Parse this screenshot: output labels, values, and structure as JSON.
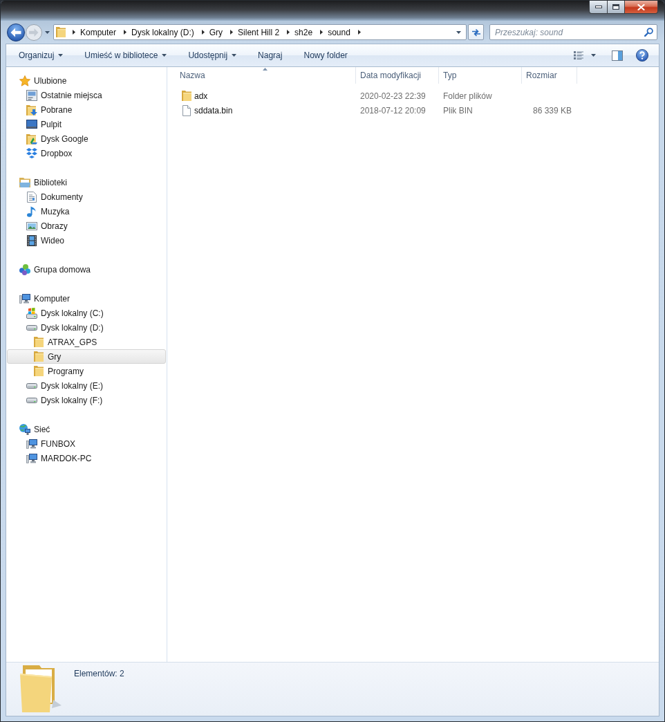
{
  "navigation": {
    "back_enabled": true,
    "forward_enabled": false,
    "breadcrumbs": [
      "Komputer",
      "Dysk lokalny (D:)",
      "Gry",
      "Silent Hill 2",
      "sh2e",
      "sound"
    ]
  },
  "search": {
    "placeholder": "Przeszukaj: sound"
  },
  "toolbar": {
    "items": [
      {
        "label": "Organizuj",
        "menu": true
      },
      {
        "label": "Umieść w bibliotece",
        "menu": true
      },
      {
        "label": "Udostępnij",
        "menu": true
      },
      {
        "label": "Nagraj",
        "menu": false
      },
      {
        "label": "Nowy folder",
        "menu": false
      }
    ]
  },
  "sidebar": {
    "items": [
      {
        "label": "Ulubione",
        "kind": "favorites",
        "selected": false,
        "children": [
          {
            "label": "Ostatnie miejsca",
            "kind": "recent",
            "selected": false
          },
          {
            "label": "Pobrane",
            "kind": "downloads",
            "selected": false
          },
          {
            "label": "Pulpit",
            "kind": "desktop",
            "selected": false
          },
          {
            "label": "Dysk Google",
            "kind": "gdrive",
            "selected": false
          },
          {
            "label": "Dropbox",
            "kind": "dropbox",
            "selected": false
          }
        ]
      },
      {
        "label": "Biblioteki",
        "kind": "libraries",
        "selected": false,
        "children": [
          {
            "label": "Dokumenty",
            "kind": "documents",
            "selected": false
          },
          {
            "label": "Muzyka",
            "kind": "music",
            "selected": false
          },
          {
            "label": "Obrazy",
            "kind": "pictures",
            "selected": false
          },
          {
            "label": "Wideo",
            "kind": "videos",
            "selected": false
          }
        ]
      },
      {
        "label": "Grupa domowa",
        "kind": "homegroup",
        "selected": false
      },
      {
        "label": "Komputer",
        "kind": "computer",
        "selected": false,
        "children": [
          {
            "label": "Dysk lokalny (C:)",
            "kind": "sysdrive",
            "selected": false
          },
          {
            "label": "Dysk lokalny (D:)",
            "kind": "drive",
            "selected": false,
            "children": [
              {
                "label": "ATRAX_GPS",
                "kind": "folder",
                "selected": false
              },
              {
                "label": "Gry",
                "kind": "folder",
                "selected": true
              },
              {
                "label": "Programy",
                "kind": "folder",
                "selected": false
              }
            ]
          },
          {
            "label": "Dysk lokalny (E:)",
            "kind": "drive",
            "selected": false
          },
          {
            "label": "Dysk lokalny (F:)",
            "kind": "drive",
            "selected": false
          }
        ]
      },
      {
        "label": "Sieć",
        "kind": "network",
        "selected": false,
        "children": [
          {
            "label": "FUNBOX",
            "kind": "pc",
            "selected": false
          },
          {
            "label": "MARDOK-PC",
            "kind": "pc",
            "selected": false
          }
        ]
      }
    ]
  },
  "file_list": {
    "columns": [
      {
        "label": "Nazwa",
        "sorted": true
      },
      {
        "label": "Data modyfikacji",
        "sorted": false
      },
      {
        "label": "Typ",
        "sorted": false
      },
      {
        "label": "Rozmiar",
        "sorted": false
      }
    ],
    "rows": [
      {
        "kind": "folder",
        "name": "adx",
        "modified": "2020-02-23 22:39",
        "type": "Folder plików"
      },
      {
        "kind": "file",
        "name": "sddata.bin",
        "modified": "2018-07-12 20:09",
        "type": "Plik BIN",
        "size": "86 339 KB"
      }
    ]
  },
  "status_bar": {
    "text": "Elementów: 2"
  }
}
